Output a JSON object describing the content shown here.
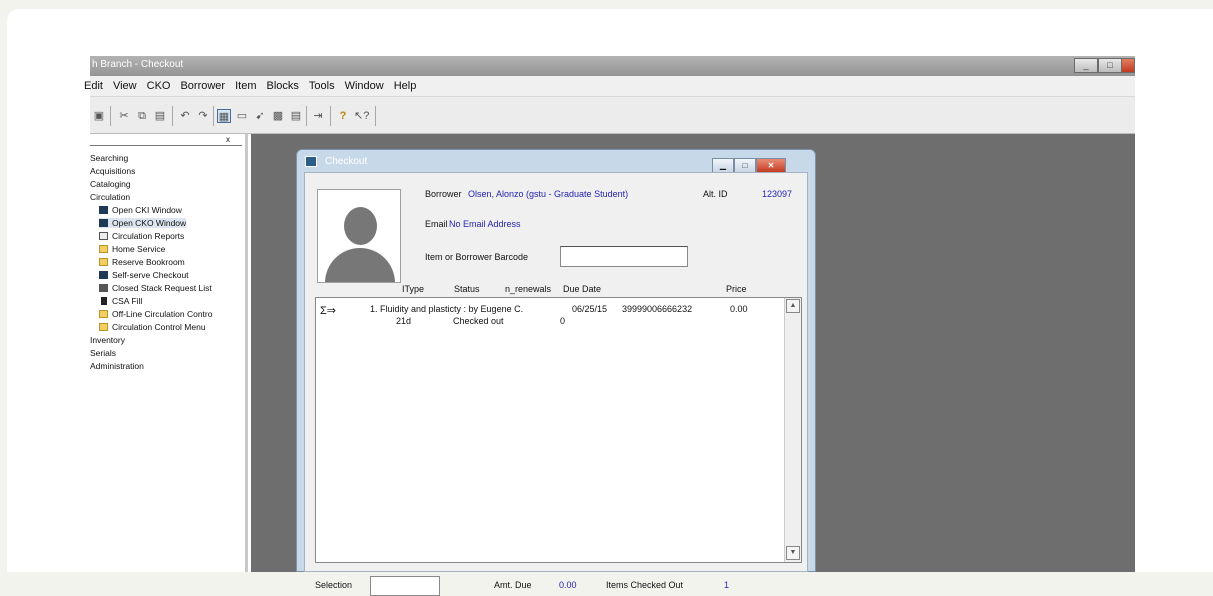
{
  "app": {
    "title": "h Branch - Checkout",
    "window_buttons": {
      "minimize": "_",
      "maximize": "□"
    },
    "menus": [
      "Edit",
      "View",
      "CKO",
      "Borrower",
      "Item",
      "Blocks",
      "Tools",
      "Window",
      "Help"
    ],
    "menu_first": "Edit"
  },
  "sidebar": {
    "close_glyph": "x",
    "top_items": [
      "Searching",
      "Acquisitions",
      "Cataloging",
      "Circulation"
    ],
    "circ_items": [
      {
        "label": "Open CKI Window",
        "icon": "window-icon"
      },
      {
        "label": "Open CKO Window",
        "icon": "window-icon"
      },
      {
        "label": "Circulation Reports",
        "icon": "report-icon"
      },
      {
        "label": "Home Service",
        "icon": "folder-icon"
      },
      {
        "label": "Reserve Bookroom",
        "icon": "folder-icon"
      },
      {
        "label": "Self-serve Checkout",
        "icon": "window-icon"
      },
      {
        "label": "Closed Stack Request List",
        "icon": "grid-icon"
      },
      {
        "label": "CSA Fill",
        "icon": "bin-icon"
      },
      {
        "label": "Off-Line Circulation Contro",
        "icon": "folder-icon"
      },
      {
        "label": "Circulation Control Menu",
        "icon": "folder-icon"
      }
    ],
    "bottom_items": [
      "Inventory",
      "Serials",
      "Administration"
    ],
    "selected": "Open CKO Window"
  },
  "checkout": {
    "title": "Checkout",
    "borrower_label": "Borrower",
    "borrower_value": "Olsen, Alonzo (gstu - Graduate Student)",
    "altid_label": "Alt. ID",
    "altid_value": "123097",
    "email_label": "Email",
    "email_value": "No Email Address",
    "barcode_label": "Item or Borrower Barcode",
    "barcode_value": "",
    "columns": {
      "itype": "IType",
      "status": "Status",
      "renewals": "n_renewals",
      "due": "Due Date",
      "price": "Price"
    },
    "item": {
      "line1": "1. Fluidity and plasticty : by Eugene C.",
      "due": "06/25/15",
      "barcode": "39999006666232",
      "price": "0.00",
      "itype": "21d",
      "status": "Checked out",
      "renewals": "0"
    },
    "selection_label": "Selection",
    "amt_label": "Amt. Due",
    "amt_value": "0.00",
    "items_label": "Items Checked Out",
    "items_value": "1"
  },
  "colors": {
    "title_blue": "#2424b0",
    "window_frame": "#c7d9e9",
    "mdi": "#6e6e6e"
  }
}
